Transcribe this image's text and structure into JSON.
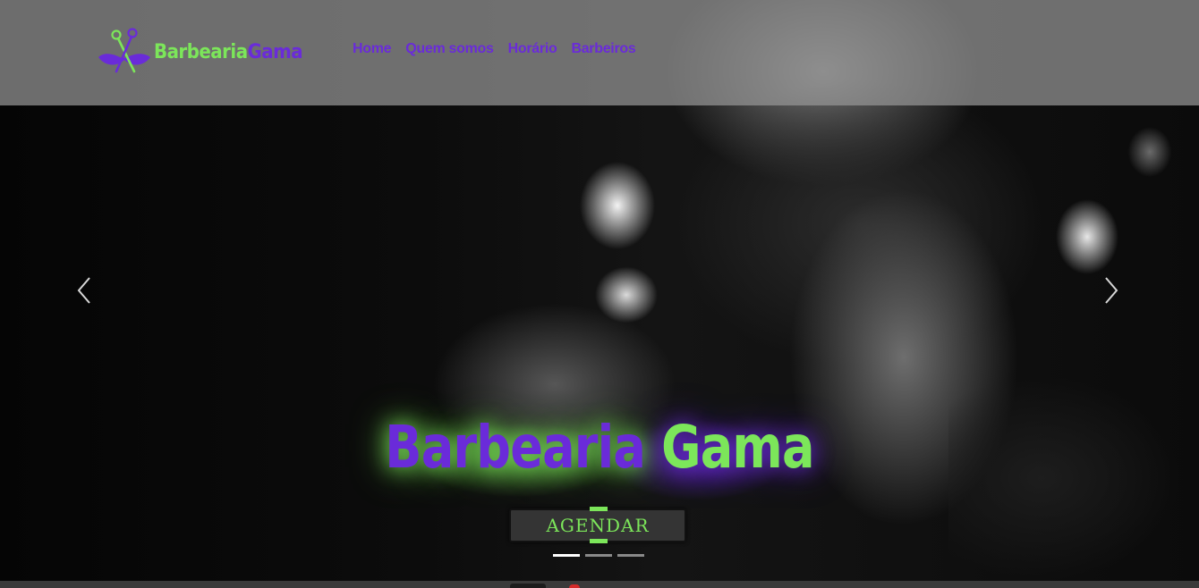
{
  "header": {
    "logo": {
      "text_part1": "Barbearia",
      "text_part2": "Gama",
      "icon": "scissors-mustache-icon"
    },
    "nav": [
      {
        "label": "Home"
      },
      {
        "label": "Quem somos"
      },
      {
        "label": "Horário"
      },
      {
        "label": "Barbeiros"
      }
    ]
  },
  "hero": {
    "title_part1": "Barbearia",
    "title_part2": "Gama",
    "cta_label": "AGENDAR",
    "prev_icon": "chevron-left-icon",
    "next_icon": "chevron-right-icon",
    "slides_count": 3,
    "active_slide": 1
  },
  "colors": {
    "brand_purple": "#6A2BD9",
    "brand_green": "#7CE65A",
    "header_bg": "rgba(150,150,150,0.72)"
  }
}
